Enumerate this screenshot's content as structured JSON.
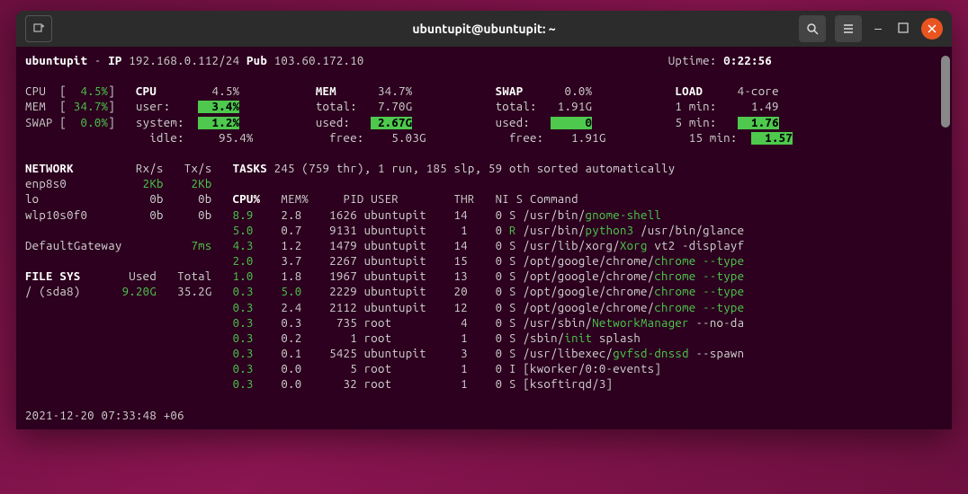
{
  "title": "ubuntupit@ubuntupit: ~",
  "header": {
    "host": "ubuntupit",
    "ip_label": "IP",
    "ip": "192.168.0.112/24",
    "pub_label": "Pub",
    "pub": "103.60.172.10",
    "uptime_label": "Uptime:",
    "uptime": "0:22:56"
  },
  "left_summary": {
    "cpu_label": "CPU ",
    "cpu": "  4.5%",
    "mem_label": "MEM ",
    "mem": " 34.7%",
    "swap_label": "SWAP",
    "swap": "  0.0%"
  },
  "cpu_block": {
    "title": "CPU",
    "total": "4.5%",
    "rows": [
      {
        "label": "user:",
        "val": "3.4%",
        "hl": true
      },
      {
        "label": "system:",
        "val": "1.2%",
        "hl": true
      },
      {
        "label": "idle:",
        "val": "95.4%",
        "hl": false
      }
    ]
  },
  "mem_block": {
    "title": "MEM",
    "total_pct": "34.7%",
    "rows": [
      {
        "label": "total:",
        "val": "7.70G"
      },
      {
        "label": "used:",
        "val": "2.67G",
        "hl": true
      },
      {
        "label": "free:",
        "val": "5.03G"
      }
    ]
  },
  "swap_block": {
    "title": "SWAP",
    "total_pct": "0.0%",
    "rows": [
      {
        "label": "total:",
        "val": "1.91G"
      },
      {
        "label": "used:",
        "val": "0",
        "hl": true
      },
      {
        "label": "free:",
        "val": "1.91G"
      }
    ]
  },
  "load_block": {
    "title": "LOAD",
    "cores": "4-core",
    "rows": [
      {
        "label": "1 min:",
        "val": "1.49"
      },
      {
        "label": "5 min:",
        "val": "1.76",
        "hl": true
      },
      {
        "label": "15 min:",
        "val": "1.57",
        "hl": true
      }
    ]
  },
  "network": {
    "title": "NETWORK",
    "hdr_rx": "Rx/s",
    "hdr_tx": "Tx/s",
    "rows": [
      {
        "iface": "enp8s0",
        "rx": "2Kb",
        "tx": "2Kb",
        "g": true
      },
      {
        "iface": "lo",
        "rx": "0b",
        "tx": "0b"
      },
      {
        "iface": "wlp10s0f0",
        "rx": "0b",
        "tx": "0b"
      }
    ],
    "gateway_label": "DefaultGateway",
    "gateway_val": "7ms"
  },
  "filesys": {
    "title": "FILE SYS",
    "hdr_used": "Used",
    "hdr_total": "Total",
    "rows": [
      {
        "name": "/ (sda8)",
        "used": "9.20G",
        "total": "35.2G"
      }
    ]
  },
  "tasks": {
    "title": "TASKS",
    "summary": "245 (759 thr), 1 run, 185 slp, 59 oth sorted automatically",
    "columns": [
      "CPU%",
      "MEM%",
      "PID",
      "USER",
      "THR",
      "NI",
      "S",
      "Command"
    ],
    "rows": [
      {
        "cpu": "8.9",
        "mem": "2.8",
        "pid": "1626",
        "user": "ubuntupit",
        "thr": "14",
        "ni": "0",
        "s": "S",
        "cmd_pre": "/usr/bin/",
        "cmd_hl": "gnome-shell",
        "cmd_post": ""
      },
      {
        "cpu": "5.0",
        "mem": "0.7",
        "pid": "9131",
        "user": "ubuntupit",
        "thr": "1",
        "ni": "0",
        "s": "R",
        "cmd_pre": "/usr/bin/",
        "cmd_hl": "python3",
        "cmd_post": " /usr/bin/glance",
        "s_green": true
      },
      {
        "cpu": "4.3",
        "mem": "1.2",
        "pid": "1479",
        "user": "ubuntupit",
        "thr": "14",
        "ni": "0",
        "s": "S",
        "cmd_pre": "/usr/lib/xorg/",
        "cmd_hl": "Xorg",
        "cmd_post": " vt2 -displayf"
      },
      {
        "cpu": "2.0",
        "mem": "3.7",
        "pid": "2267",
        "user": "ubuntupit",
        "thr": "15",
        "ni": "0",
        "s": "S",
        "cmd_pre": "/opt/google/chrome/",
        "cmd_hl": "chrome",
        "cmd_post": " ",
        "cmd_hl2": "--type"
      },
      {
        "cpu": "1.0",
        "mem": "1.8",
        "pid": "1967",
        "user": "ubuntupit",
        "thr": "13",
        "ni": "0",
        "s": "S",
        "cmd_pre": "/opt/google/chrome/",
        "cmd_hl": "chrome",
        "cmd_post": " ",
        "cmd_hl2": "--type"
      },
      {
        "cpu": "0.3",
        "mem": "5.0",
        "pid": "2229",
        "user": "ubuntupit",
        "thr": "20",
        "ni": "0",
        "s": "S",
        "cmd_pre": "/opt/google/chrome/",
        "cmd_hl": "chrome",
        "cmd_post": " ",
        "cmd_hl2": "--type",
        "mem_hl": true
      },
      {
        "cpu": "0.3",
        "mem": "2.4",
        "pid": "2112",
        "user": "ubuntupit",
        "thr": "12",
        "ni": "0",
        "s": "S",
        "cmd_pre": "/opt/google/chrome/",
        "cmd_hl": "chrome",
        "cmd_post": " ",
        "cmd_hl2": "--type"
      },
      {
        "cpu": "0.3",
        "mem": "0.3",
        "pid": "735",
        "user": "root",
        "thr": "4",
        "ni": "0",
        "s": "S",
        "cmd_pre": "/usr/sbin/",
        "cmd_hl": "NetworkManager",
        "cmd_post": " --no-da"
      },
      {
        "cpu": "0.3",
        "mem": "0.2",
        "pid": "1",
        "user": "root",
        "thr": "1",
        "ni": "0",
        "s": "S",
        "cmd_pre": "/sbin/",
        "cmd_hl": "init",
        "cmd_post": " splash"
      },
      {
        "cpu": "0.3",
        "mem": "0.1",
        "pid": "5425",
        "user": "ubuntupit",
        "thr": "3",
        "ni": "0",
        "s": "S",
        "cmd_pre": "/usr/libexec/",
        "cmd_hl": "gvfsd-dnssd",
        "cmd_post": " --spawn"
      },
      {
        "cpu": "0.3",
        "mem": "0.0",
        "pid": "5",
        "user": "root",
        "thr": "1",
        "ni": "0",
        "s": "I",
        "cmd_pre": "[kworker/0:0-events]",
        "cmd_hl": "",
        "cmd_post": ""
      },
      {
        "cpu": "0.3",
        "mem": "0.0",
        "pid": "32",
        "user": "root",
        "thr": "1",
        "ni": "0",
        "s": "S",
        "cmd_pre": "[ksoftirqd/3]",
        "cmd_hl": "",
        "cmd_post": ""
      }
    ]
  },
  "timestamp": "2021-12-20 07:33:48 +06"
}
